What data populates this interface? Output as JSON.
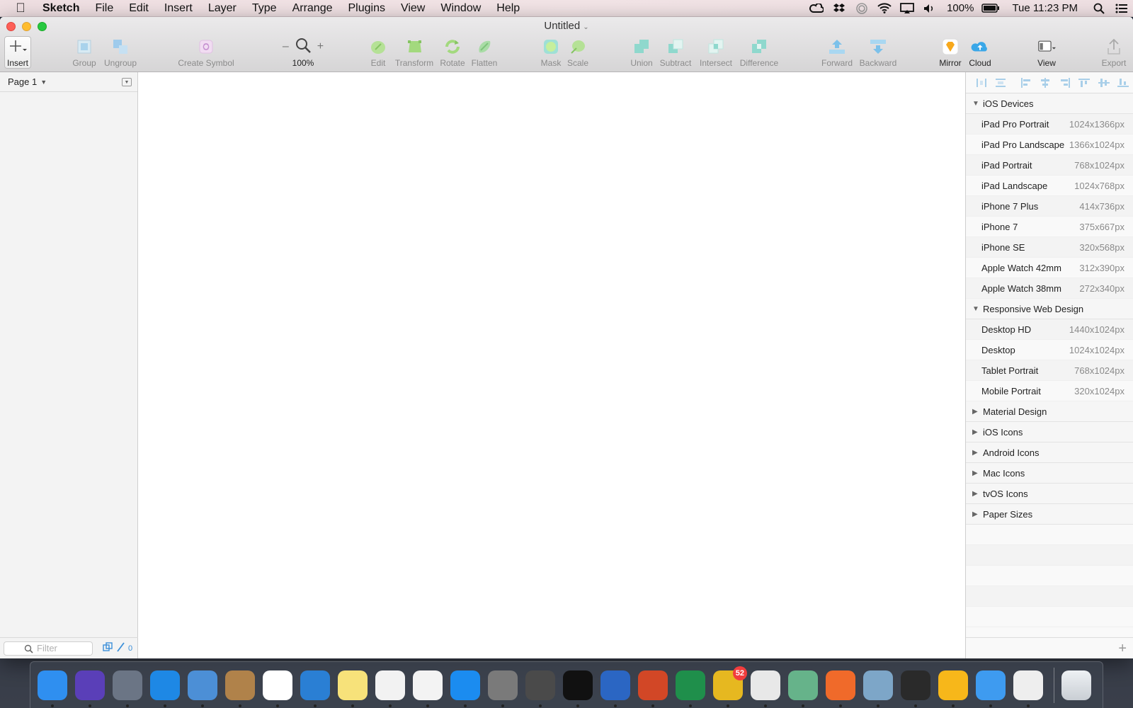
{
  "menubar": {
    "app_name": "Sketch",
    "items": [
      "File",
      "Edit",
      "Insert",
      "Layer",
      "Type",
      "Arrange",
      "Plugins",
      "View",
      "Window",
      "Help"
    ],
    "battery": "100%",
    "clock": "Tue 11:23 PM"
  },
  "window": {
    "title": "Untitled"
  },
  "toolbar": {
    "insert": "Insert",
    "group": "Group",
    "ungroup": "Ungroup",
    "create_symbol": "Create Symbol",
    "zoom_minus": "–",
    "zoom_plus": "+",
    "zoom": "100%",
    "edit": "Edit",
    "transform": "Transform",
    "rotate": "Rotate",
    "flatten": "Flatten",
    "mask": "Mask",
    "scale": "Scale",
    "union": "Union",
    "subtract": "Subtract",
    "intersect": "Intersect",
    "difference": "Difference",
    "forward": "Forward",
    "backward": "Backward",
    "mirror": "Mirror",
    "cloud": "Cloud",
    "view": "View",
    "export": "Export"
  },
  "left_panel": {
    "page": "Page 1",
    "filter_placeholder": "Filter",
    "slice_count": "0"
  },
  "right_panel": {
    "groups": [
      {
        "name": "iOS Devices",
        "expanded": true,
        "presets": [
          {
            "name": "iPad Pro Portrait",
            "size": "1024x1366px"
          },
          {
            "name": "iPad Pro Landscape",
            "size": "1366x1024px"
          },
          {
            "name": "iPad Portrait",
            "size": "768x1024px"
          },
          {
            "name": "iPad Landscape",
            "size": "1024x768px"
          },
          {
            "name": "iPhone 7 Plus",
            "size": "414x736px"
          },
          {
            "name": "iPhone 7",
            "size": "375x667px"
          },
          {
            "name": "iPhone SE",
            "size": "320x568px"
          },
          {
            "name": "Apple Watch 42mm",
            "size": "312x390px"
          },
          {
            "name": "Apple Watch 38mm",
            "size": "272x340px"
          }
        ]
      },
      {
        "name": "Responsive Web Design",
        "expanded": true,
        "presets": [
          {
            "name": "Desktop HD",
            "size": "1440x1024px"
          },
          {
            "name": "Desktop",
            "size": "1024x1024px"
          },
          {
            "name": "Tablet Portrait",
            "size": "768x1024px"
          },
          {
            "name": "Mobile Portrait",
            "size": "320x1024px"
          }
        ]
      },
      {
        "name": "Material Design",
        "expanded": false,
        "presets": []
      },
      {
        "name": "iOS Icons",
        "expanded": false,
        "presets": []
      },
      {
        "name": "Android Icons",
        "expanded": false,
        "presets": []
      },
      {
        "name": "Mac Icons",
        "expanded": false,
        "presets": []
      },
      {
        "name": "tvOS Icons",
        "expanded": false,
        "presets": []
      },
      {
        "name": "Paper Sizes",
        "expanded": false,
        "presets": []
      }
    ]
  },
  "dock": {
    "apps": [
      {
        "icon": "finder-icon",
        "color": "#2f8ff0"
      },
      {
        "icon": "siri-icon",
        "color": "#5a3fb8"
      },
      {
        "icon": "launchpad-icon",
        "color": "#6b7585"
      },
      {
        "icon": "safari-icon",
        "color": "#1e88e5"
      },
      {
        "icon": "mail-icon",
        "color": "#4c8fd6"
      },
      {
        "icon": "contacts-icon",
        "color": "#b0824a"
      },
      {
        "icon": "calendar-icon",
        "color": "#ffffff"
      },
      {
        "icon": "keynote-icon",
        "color": "#2a7fd4"
      },
      {
        "icon": "notes-icon",
        "color": "#f7e27a"
      },
      {
        "icon": "reminders-icon",
        "color": "#f2f2f2"
      },
      {
        "icon": "photos-icon",
        "color": "#f3f3f3"
      },
      {
        "icon": "app-store-icon",
        "color": "#1b8cf0"
      },
      {
        "icon": "system-preferences-icon",
        "color": "#7a7a7a"
      },
      {
        "icon": "sublime-text-icon",
        "color": "#4a4a4a"
      },
      {
        "icon": "terminal-icon",
        "color": "#111111"
      },
      {
        "icon": "word-icon",
        "color": "#2b66c3"
      },
      {
        "icon": "powerpoint-icon",
        "color": "#d24726"
      },
      {
        "icon": "excel-icon",
        "color": "#1f8f4b"
      },
      {
        "icon": "outlook-icon",
        "color": "#e6b820",
        "badge": "52"
      },
      {
        "icon": "chrome-icon",
        "color": "#e8e8e8"
      },
      {
        "icon": "atom-icon",
        "color": "#66b38a"
      },
      {
        "icon": "sketch-tool-icon",
        "color": "#f06a2a"
      },
      {
        "icon": "preview-icon",
        "color": "#7da6c8"
      },
      {
        "icon": "vectorize-icon",
        "color": "#2a2a2a"
      },
      {
        "icon": "sketch-icon",
        "color": "#f7b71a"
      },
      {
        "icon": "framer-icon",
        "color": "#3e9bf0"
      },
      {
        "icon": "screen-recorder-icon",
        "color": "#eeeeee"
      }
    ],
    "trash": "trash-icon"
  },
  "colors": {
    "accent": "#3b8fd9",
    "teal_tool": "#7fd3c8",
    "green_tool": "#a8d77c"
  }
}
